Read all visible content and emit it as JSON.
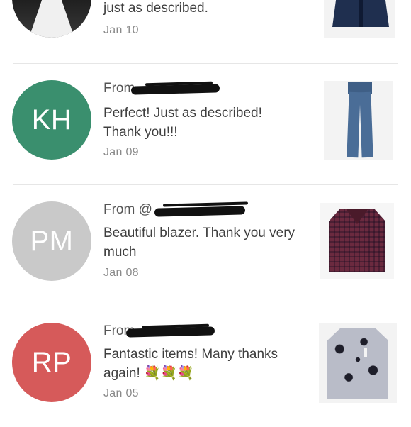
{
  "reviews": [
    {
      "avatar": {
        "initials": "",
        "color": "#2a2a2a"
      },
      "from_prefix": "",
      "message": "just as described.",
      "date": "Jan 10",
      "thumbnail": "navy-blazer-photo"
    },
    {
      "avatar": {
        "initials": "KH",
        "color": "#3a8f6e"
      },
      "from_prefix": "From",
      "message": "Perfect! Just as described! Thank you!!!",
      "date": "Jan 09",
      "thumbnail": "skinny-jeans-photo"
    },
    {
      "avatar": {
        "initials": "PM",
        "color": "#c9c9c9"
      },
      "from_prefix": "From @",
      "message": "Beautiful blazer. Thank you very much",
      "date": "Jan 08",
      "thumbnail": "plaid-blazer-photo"
    },
    {
      "avatar": {
        "initials": "RP",
        "color": "#d65a5a"
      },
      "from_prefix": "From",
      "message": "Fantastic items! Many thanks again!",
      "emoji": "💐💐💐",
      "date": "Jan 05",
      "thumbnail": "printed-blouse-photo"
    }
  ]
}
